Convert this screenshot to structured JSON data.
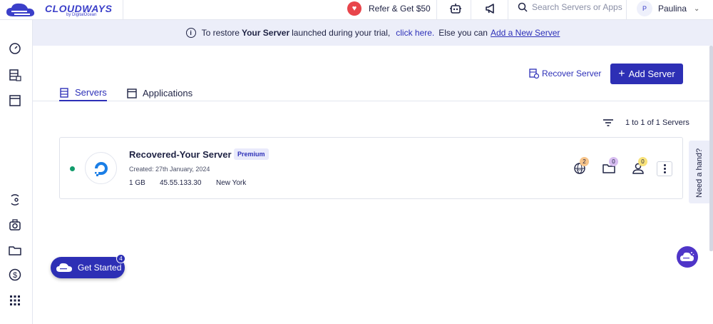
{
  "brand": {
    "name": "CLOUDWAYS",
    "by": "by DigitalOcean",
    "color": "#3b3fc9"
  },
  "topbar": {
    "refer_label": "Refer & Get $50",
    "search_placeholder": "Search Servers or Apps",
    "user_initial": "P",
    "user_name": "Paulina",
    "icons": [
      "heart-icon",
      "robot-icon",
      "megaphone-icon",
      "search-icon",
      "chevron-down-icon"
    ]
  },
  "sidebar": {
    "icons": [
      "speedometer-icon",
      "servers-icon",
      "applications-icon",
      "team-icon",
      "addons-icon",
      "projects-icon",
      "billing-icon",
      "apps-grid-icon"
    ]
  },
  "banner": {
    "prefix": "To restore",
    "bold": "Your Server",
    "middle": "launched during your trial,",
    "link1": "click here.",
    "middle2": "Else you can",
    "link2": "Add a New Server"
  },
  "actions": {
    "recover_label": "Recover Server",
    "add_label": "Add Server"
  },
  "tabs": [
    {
      "label": "Servers",
      "active": true
    },
    {
      "label": "Applications",
      "active": false
    }
  ],
  "list": {
    "count_text": "1 to 1 of 1 Servers"
  },
  "server": {
    "name": "Recovered-Your Server",
    "badge": "Premium",
    "created": "Created: 27th January, 2024",
    "size": "1 GB",
    "ip": "45.55.133.30",
    "location": "New York",
    "status_color": "#119b6b",
    "counts": {
      "websites": "2",
      "projects": "0",
      "users": "0"
    },
    "count_colors": {
      "websites": "#f7c48a",
      "projects": "#d7bdf0",
      "users": "#f8e27a"
    }
  },
  "help": {
    "label": "Need a hand?"
  },
  "getstarted": {
    "label": "Get Started",
    "count": "4"
  }
}
